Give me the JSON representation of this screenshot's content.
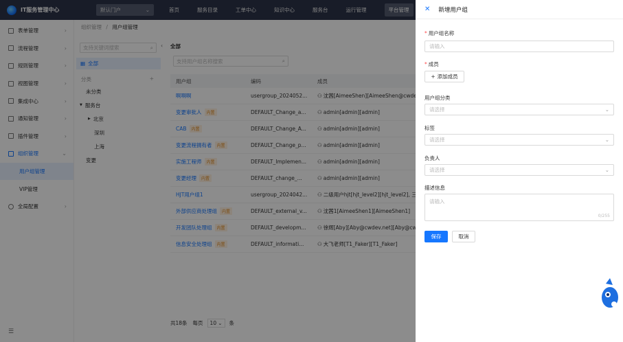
{
  "app": {
    "title": "IT服务管理中心",
    "portal": "默认门户"
  },
  "topnav": [
    "首页",
    "服务目录",
    "工单中心",
    "知识中心",
    "服务台",
    "运行管理",
    "平台管理"
  ],
  "sidebar": {
    "items": [
      "表单管理",
      "流程管理",
      "规则管理",
      "视图管理",
      "集成中心",
      "通知管理",
      "插件管理",
      "组织管理"
    ],
    "subitems": [
      "用户组管理",
      "VIP管理"
    ],
    "bottom": "全局配置"
  },
  "breadcrumb": {
    "parent": "组织管理",
    "sep": "/",
    "current": "用户组管理"
  },
  "tree": {
    "search_placeholder": "支持关键词搜索",
    "all": "全部",
    "category_label": "分类",
    "nodes": [
      "未分类",
      "服务台",
      "北京",
      "深圳",
      "上海",
      "变更"
    ]
  },
  "main": {
    "title": "全部",
    "search_placeholder": "支持用户组名称搜索",
    "columns": [
      "用户组",
      "编码",
      "成员"
    ],
    "rows": [
      {
        "name": "啊啊啊",
        "tag": "",
        "code": "usergroup_2024052...",
        "members": "沈茜[AimeeShen][AimeeShen@cwdev.n"
      },
      {
        "name": "变更审批人",
        "tag": "内置",
        "code": "DEFAULT_Change_a...",
        "members": "admin[admin][admin]"
      },
      {
        "name": "CAB",
        "tag": "内置",
        "code": "DEFAULT_Change_A...",
        "members": "admin[admin][admin]"
      },
      {
        "name": "变更流程拥有者",
        "tag": "内置",
        "code": "DEFAULT_Change_p...",
        "members": "admin[admin][admin]"
      },
      {
        "name": "实施工程师",
        "tag": "内置",
        "code": "DEFAULT_Implemen...",
        "members": "admin[admin][admin]"
      },
      {
        "name": "变更经理",
        "tag": "内置",
        "code": "DEFAULT_change_...",
        "members": "admin[admin][admin]"
      },
      {
        "name": "HJT用户组1",
        "tag": "",
        "code": "usergroup_2024042...",
        "members": "二级用户hjt[hjt_level2][hjt_level2], 三"
      },
      {
        "name": "外部供应商处理组",
        "tag": "内置",
        "code": "DEFAULT_external_v...",
        "members": "沈茜1[AimeeShen1][AimeeShen1]"
      },
      {
        "name": "开发团队处理组",
        "tag": "内置",
        "code": "DEFAULT_developm...",
        "members": "徐辉[Aby][Aby@cwdev.net][Aby@cwdev"
      },
      {
        "name": "信息安全处理组",
        "tag": "内置",
        "code": "DEFAULT_informati...",
        "members": "大飞老师[T1_Faker][T1_Faker]"
      }
    ],
    "pager": {
      "total": "共18条",
      "per_page": "每页",
      "size": "10",
      "unit": "条"
    }
  },
  "drawer": {
    "title": "新增用户组",
    "name_label": "用户组名称",
    "name_placeholder": "请输入",
    "members_label": "成员",
    "add_member": "添加成员",
    "category_label": "用户组分类",
    "category_placeholder": "请选择",
    "tags_label": "标签",
    "tags_placeholder": "请选择",
    "owner_label": "负责人",
    "owner_placeholder": "请选择",
    "desc_label": "描述信息",
    "desc_placeholder": "请输入",
    "desc_counter": "0/255",
    "save": "保存",
    "cancel": "取消"
  }
}
